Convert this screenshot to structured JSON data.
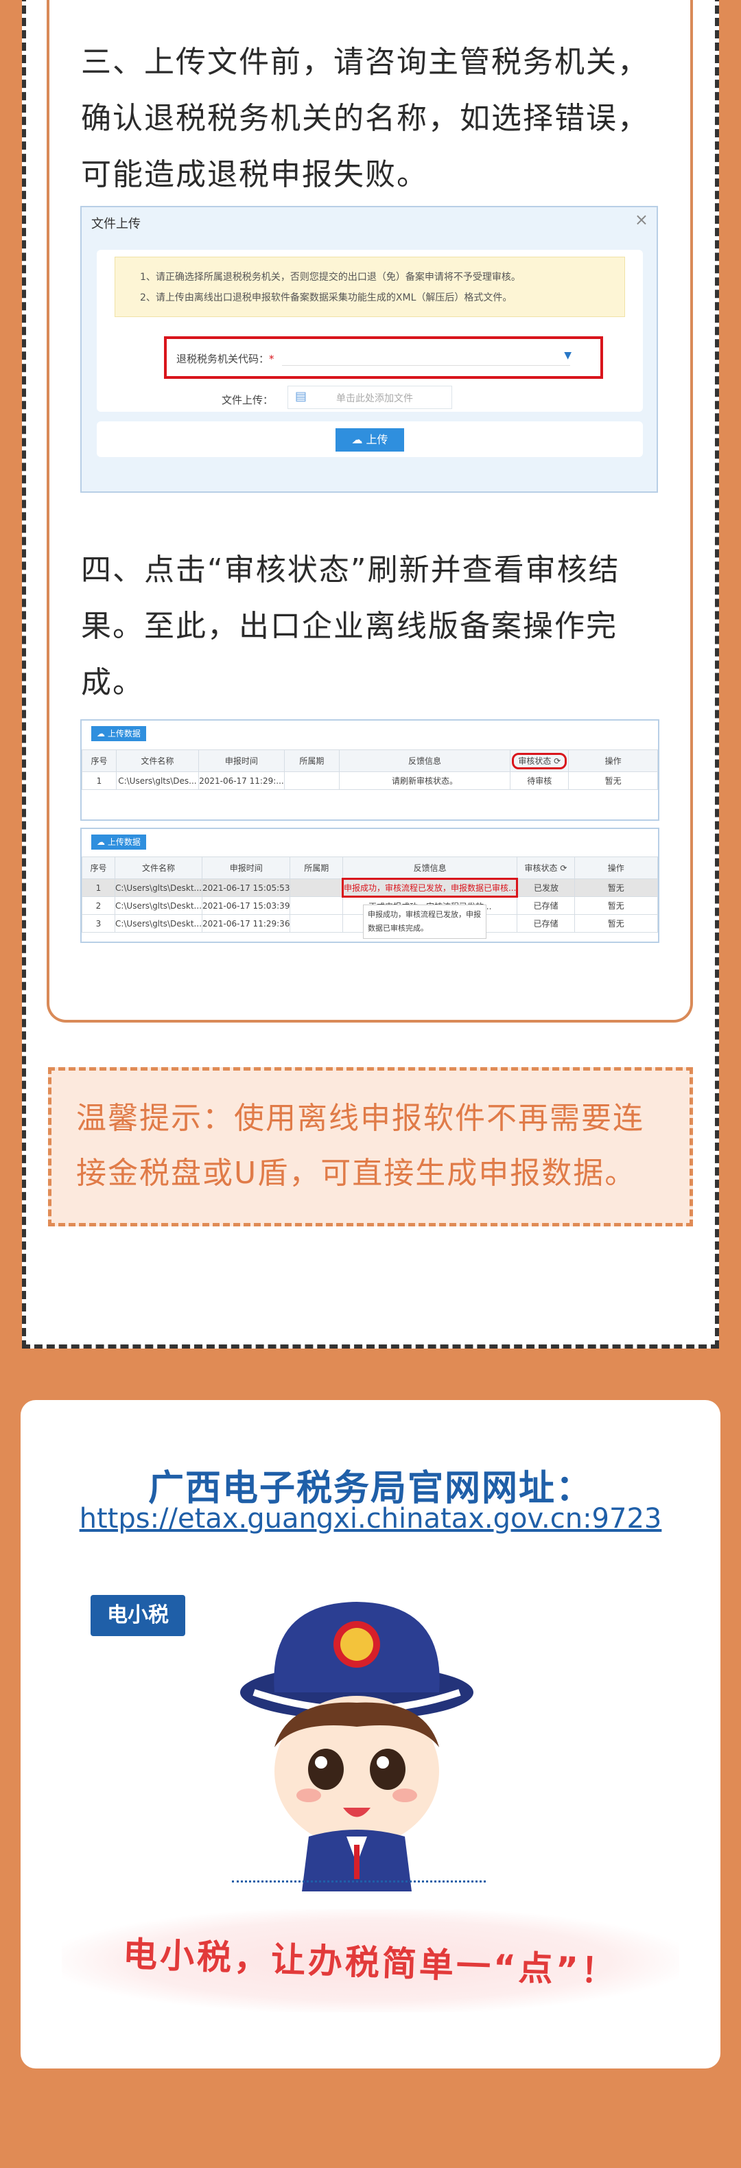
{
  "step3": {
    "text": "三、上传文件前，请咨询主管税务机关，确认退税税务机关的名称，如选择错误，可能造成退税申报失败。"
  },
  "upload_dialog": {
    "title": "文件上传",
    "close": "×",
    "notice_1": "1、请正确选择所属退税税务机关，否则您提交的出口退（免）备案申请将不予受理审核。",
    "notice_2": "2、请上传由离线出口退税申报软件备案数据采集功能生成的XML（解压后）格式文件。",
    "code_label": "退税税务机关代码：",
    "code_required": "*",
    "file_label": "文件上传：",
    "file_placeholder": "单击此处添加文件",
    "upload_button": "上传"
  },
  "step4": {
    "text": "四、点击“审核状态”刷新并查看审核结果。至此，出口企业离线版备案操作完成。"
  },
  "table1": {
    "tag": "上传数据",
    "headers": [
      "序号",
      "文件名称",
      "申报时间",
      "所属期",
      "反馈信息",
      "审核状态",
      "操作"
    ],
    "rows": [
      [
        "1",
        "C:\\Users\\glts\\Des...",
        "2021-06-17 11:29:...",
        "",
        "请刷新审核状态。",
        "待审核",
        "暂无"
      ]
    ]
  },
  "table2": {
    "tag": "上传数据",
    "headers": [
      "序号",
      "文件名称",
      "申报时间",
      "所属期",
      "反馈信息",
      "审核状态",
      "操作"
    ],
    "rows": [
      [
        "1",
        "C:\\Users\\glts\\Deskt...",
        "2021-06-17 15:05:53",
        "",
        "申报成功，审核流程已发放，申报数据已审核...",
        "已发放",
        "暂无"
      ],
      [
        "2",
        "C:\\Users\\glts\\Deskt...",
        "2021-06-17 15:03:39",
        "",
        "正式申报成功，审核流程已发放...",
        "已存储",
        "暂无"
      ],
      [
        "3",
        "C:\\Users\\glts\\Deskt...",
        "2021-06-17 11:29:36",
        "",
        "申报成功，审核流程已发放...",
        "已存储",
        "暂无"
      ]
    ],
    "tooltip": "申报成功，审核流程已发放，申报数据已审核完成。"
  },
  "tip": {
    "text": "温馨提示：使用离线申报软件不再需要连接金税盘或U盾，可直接生成申报数据。"
  },
  "card": {
    "title": "广西电子税务局官网网址：",
    "url": "https://etax.guangxi.chinatax.gov.cn:9723",
    "brand": "电小税",
    "slogan": "电小税，让办税简单一“点”！"
  },
  "colors": {
    "background": "#e08b55",
    "accent_blue": "#1f5fa8",
    "highlight_red": "#d9151c",
    "tip_text": "#e07b48"
  }
}
